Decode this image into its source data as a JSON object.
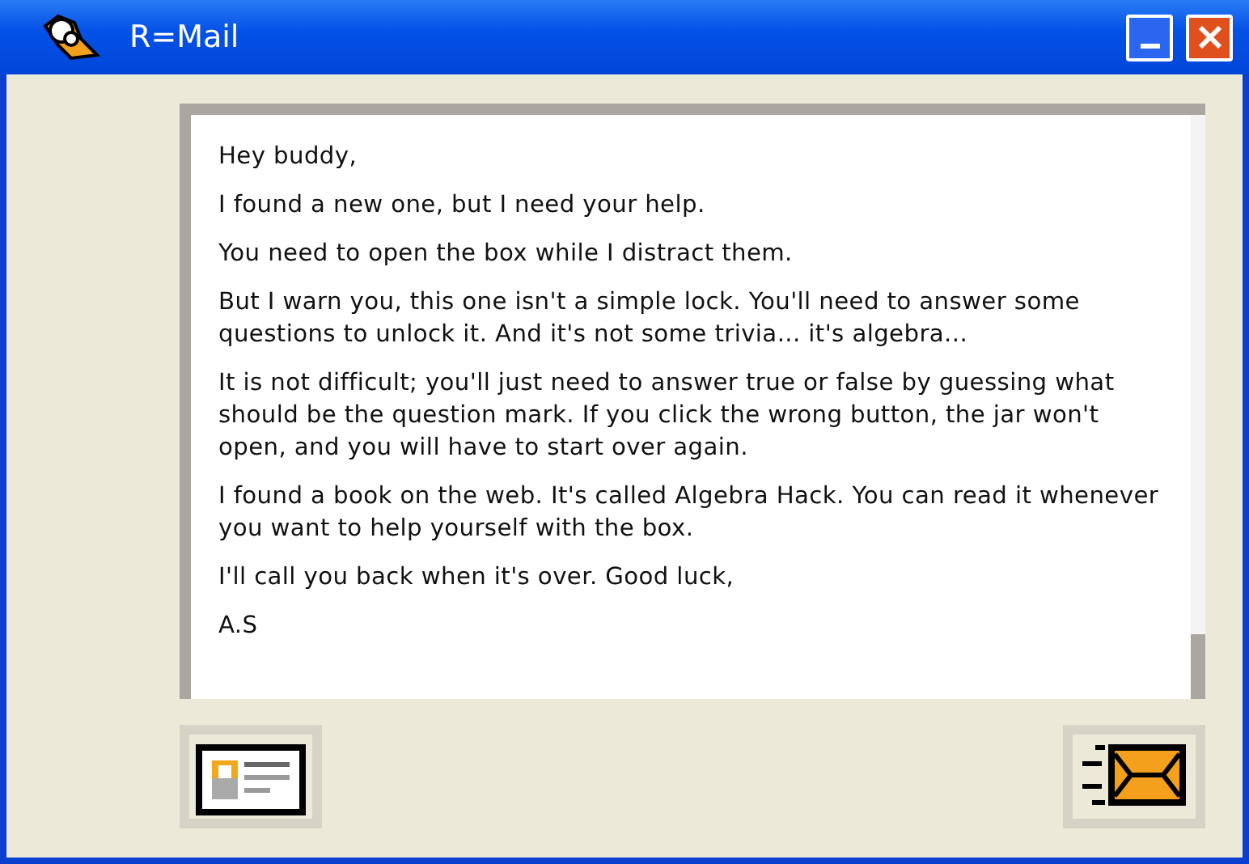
{
  "window": {
    "title": "R=Mail"
  },
  "message": {
    "paragraphs": [
      "Hey buddy,",
      "I found a new one, but I need your help.",
      "You need to open the box while I distract them.",
      "But I warn you, this one isn't a simple lock. You'll need to answer some questions to unlock it. And it's not some trivia... it's algebra...",
      "It is not difficult; you'll just need to answer true or false by guessing what should be the question mark. If you click the wrong button, the jar won't open, and you will have to start over again.",
      "I found a book on the web. It's called Algebra Hack. You can read it whenever you want to help yourself with the box.",
      "I'll call you back when it's over. Good luck,",
      "A.S"
    ]
  }
}
